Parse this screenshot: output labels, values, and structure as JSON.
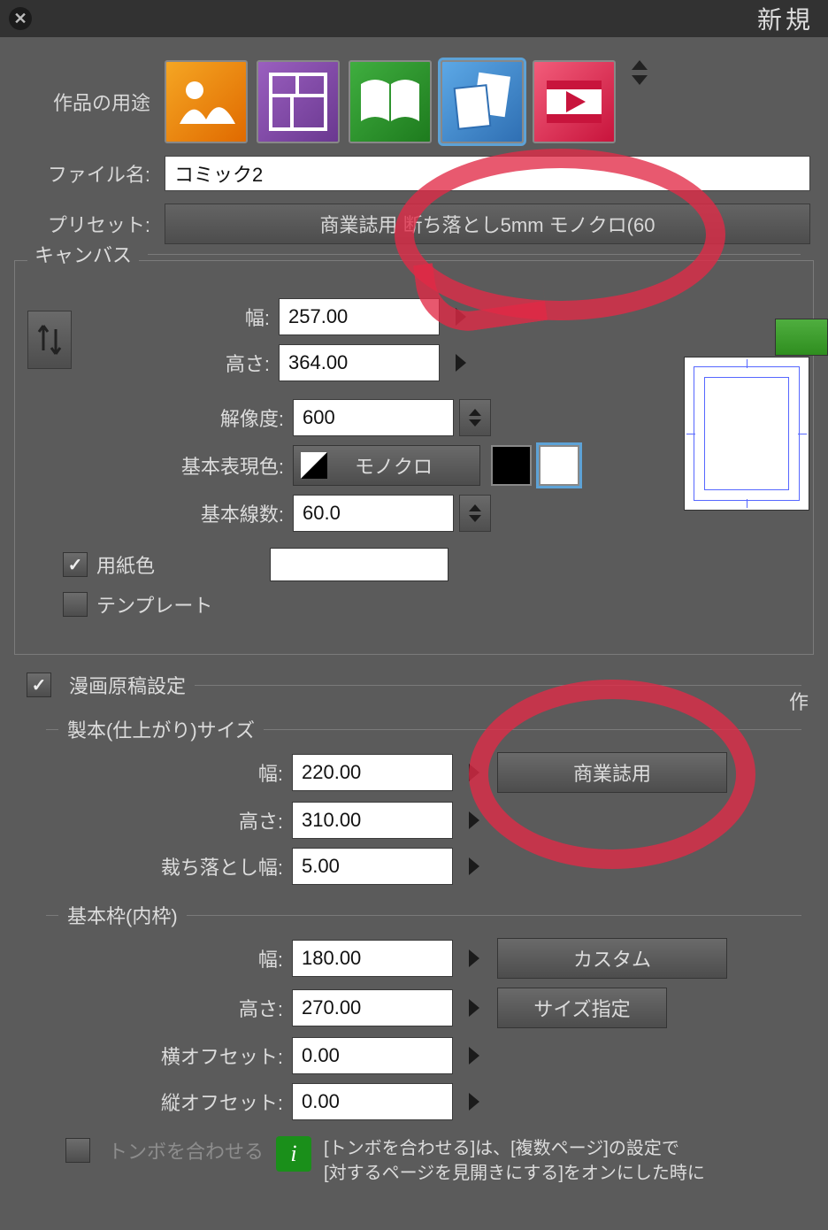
{
  "titlebar": {
    "title": "新規"
  },
  "top": {
    "purpose_label": "作品の用途",
    "file_label": "ファイル名:",
    "file_value": "コミック2",
    "preset_label": "プリセット:",
    "preset_value": "商業誌用 断ち落とし5mm モノクロ(60"
  },
  "canvas": {
    "title": "キャンバス",
    "width_label": "幅:",
    "width_value": "257.00",
    "height_label": "高さ:",
    "height_value": "364.00",
    "res_label": "解像度:",
    "res_value": "600",
    "color_label": "基本表現色:",
    "color_value": "モノクロ",
    "lines_label": "基本線数:",
    "lines_value": "60.0",
    "paper_label": "用紙色",
    "template_label": "テンプレート"
  },
  "manga": {
    "title": "漫画原稿設定",
    "finish_title": "製本(仕上がり)サイズ",
    "width_label": "幅:",
    "width_value": "220.00",
    "height_label": "高さ:",
    "height_value": "310.00",
    "bleed_label": "裁ち落とし幅:",
    "bleed_value": "5.00",
    "size_preset": "商業誌用",
    "frame_title": "基本枠(内枠)",
    "f_width_label": "幅:",
    "f_width_value": "180.00",
    "f_height_label": "高さ:",
    "f_height_value": "270.00",
    "f_hoff_label": "横オフセット:",
    "f_hoff_value": "0.00",
    "f_voff_label": "縦オフセット:",
    "f_voff_value": "0.00",
    "frame_preset1": "カスタム",
    "frame_preset2": "サイズ指定",
    "tombo_label": "トンボを合わせる",
    "info_line1": "[トンボを合わせる]は、[複数ページ]の設定で",
    "info_line2": "[対するページを見開きにする]をオンにした時に"
  },
  "right": {
    "label1": "作"
  }
}
